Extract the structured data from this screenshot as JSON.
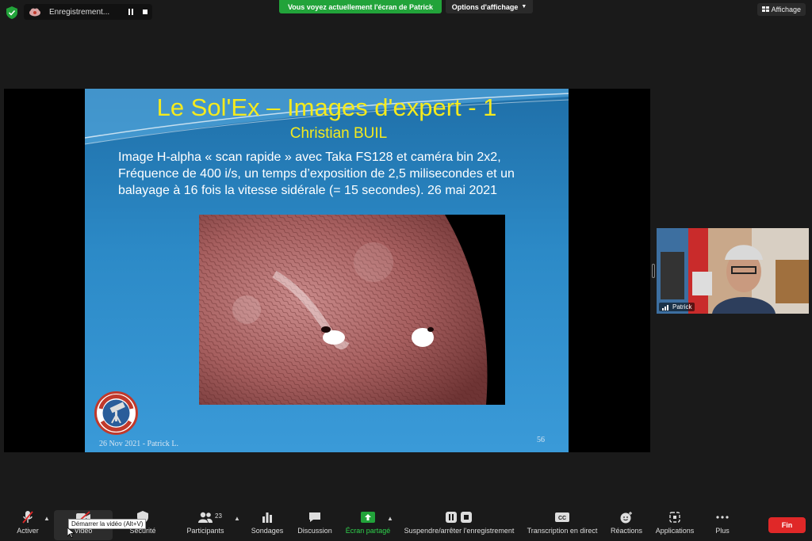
{
  "topbar": {
    "recording_label": "Enregistrement...",
    "share_banner": "Vous voyez actuellement l'écran de Patrick",
    "view_options": "Options d'affichage",
    "view_button": "Affichage"
  },
  "slide": {
    "title": "Le Sol'Ex – Images d'expert - 1",
    "subtitle": "Christian BUIL",
    "body_line1": "Image H-alpha « scan rapide » avec Taka FS128 et caméra bin 2x2,",
    "body_line2": "Fréquence de 400 i/s, un temps d’exposition de 2,5 milisecondes et un",
    "body_line3": "balayage à 16 fois la vitesse sidérale (= 15 secondes). 26 mai 2021",
    "footer": "26 Nov 2021 - Patrick L.",
    "page_number": "56",
    "logo_text_top": "CLUB D'ASTRONOMIE",
    "logo_text_bottom": "D'ANTONY"
  },
  "participant_tile": {
    "name": "Patrick"
  },
  "toolbar": {
    "mute_label": "Activer",
    "video_label": "Vidéo",
    "security_label": "Sécurité",
    "participants_label": "Participants",
    "participants_count": "23",
    "polls_label": "Sondages",
    "chat_label": "Discussion",
    "share_label": "Écran partagé",
    "record_label": "Suspendre/arrêter l'enregistrement",
    "captions_label": "Transcription en direct",
    "captions_icon_text": "CC",
    "reactions_label": "Réactions",
    "apps_label": "Applications",
    "more_label": "Plus",
    "end_label": "Fin",
    "video_tooltip": "Démarrer la vidéo (Alt+V)"
  },
  "colors": {
    "share_green": "#22a33a",
    "end_red": "#e02828",
    "slide_title_yellow": "#f4ea1e"
  }
}
